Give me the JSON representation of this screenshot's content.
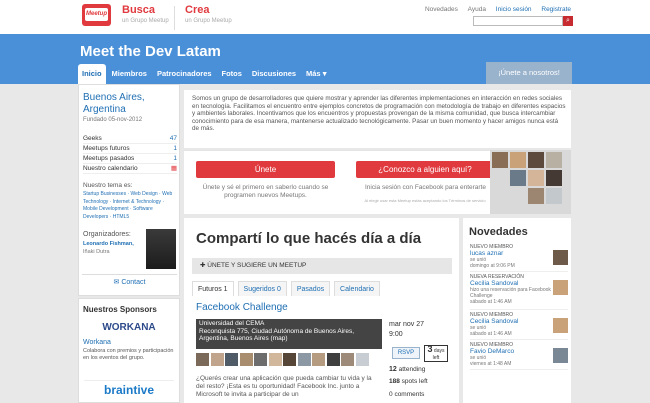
{
  "header": {
    "logo_text": "Meetup",
    "hubs": [
      {
        "title": "Busca",
        "subtitle": "un Grupo Meetup"
      },
      {
        "title": "Crea",
        "subtitle": "un Grupo Meetup"
      }
    ],
    "links": [
      "Novedades",
      "Ayuda",
      "Inicio sesión",
      "Registrate"
    ],
    "search_placeholder": ""
  },
  "group": {
    "title": "Meet the Dev Latam",
    "nav": [
      "Inicio",
      "Miembros",
      "Patrocinadores",
      "Fotos",
      "Discusiones",
      "Más ▾"
    ],
    "join_label": "¡Únete a nosotros!"
  },
  "sidebar": {
    "city": "Buenos Aires, Argentina",
    "founded": "Fundado 05-nov-2012",
    "stats": [
      {
        "label": "Geeks",
        "value": "47"
      },
      {
        "label": "Meetups futuros",
        "value": "1"
      },
      {
        "label": "Meetups pasados",
        "value": "1"
      },
      {
        "label": "Nuestro calendario",
        "value": ""
      }
    ],
    "topics_title": "Nuestro tema es:",
    "topics": "Startup Businesses · Web Design · Web Technology · Internet & Technology · Mobile Development · Software Developers · HTML5",
    "org_title": "Organizadores:",
    "org_name": "Leonardo Fishman,",
    "org_extra": "Iñaki Dutra",
    "contact_label": "Contact"
  },
  "sponsors": {
    "title": "Nuestros Sponsors",
    "logo1": "WORKANA",
    "name": "Workana",
    "desc": "Colabora con premios y participación en los eventos del grupo.",
    "logo2": "braintive"
  },
  "description": "Somos un grupo de desarrolladores que quiere mostrar y aprender las diferentes implementaciones en interacción en redes sociales en tecnología. Facilitamos el encuentro entre ejemplos concretos de programación con metodología de trabajo en diferentes espacios y ambientes laborales. Incentivamos que los encuentros y propuestas provengan de la misma comunidad, que busca intercambiar conocimiento para de esa manera, mantenerse actualizado tecnológicamente. Pasar un buen momento y hacer amigos nunca está de más.",
  "cta": {
    "join_label": "Únete",
    "join_text": "Únete y sé el primero en saberlo cuando se programen nuevos Meetups.",
    "know_label": "¿Conozco a alguien aquí?",
    "know_text": "Inicia sesión con Facebook para enterarte",
    "know_fine": "Al elegir usar esta Meetup estás aceptando los Términos de servicio"
  },
  "main": {
    "headline": "Compartí lo que hacés día a día",
    "suggest_label": "ÚNETE Y SUGIERE UN MEETUP",
    "tabs": [
      "Futuros 1",
      "Sugeridos 0",
      "Pasados",
      "Calendario"
    ],
    "event": {
      "title": "Facebook Challenge",
      "venue_name": "Universidad del CEMA",
      "venue_address": "Reconquista 775, Ciudad Autónoma de Buenos Aires, Argentina, Buenos Aires (map)",
      "date": "mar nov 27",
      "time": "9:00",
      "rsvp_label": "RSVP",
      "days_number": "3",
      "days_label": "days left",
      "attending_count": "12",
      "attending_label": "attending",
      "spots_count": "188",
      "spots_label": "spots left",
      "comments_count": "0",
      "comments_label": "comments",
      "description": "¿Querés crear una aplicación que pueda cambiar tu vida y la del resto? ¡Esta es tu oportunidad! Facebook Inc. junto a Microsoft te invita a participar de un"
    }
  },
  "news": {
    "title": "Novedades",
    "items": [
      {
        "tag": "NUEVO MIEMBRO",
        "name": "lucas aznar",
        "sub": "se unió",
        "time": "domingo at 9:06 PM"
      },
      {
        "tag": "NUEVA RESERVACIÓN",
        "name": "Cecilia Sandoval",
        "sub": "hizo una reservación para Facebook Challenge",
        "time": "sábado at 1:46 AM"
      },
      {
        "tag": "NUEVO MIEMBRO",
        "name": "Cecilia Sandoval",
        "sub": "se unió",
        "time": "sábado at 1:46 AM"
      },
      {
        "tag": "NUEVO MIEMBRO",
        "name": "Favio DeMarco",
        "sub": "se unió",
        "time": "viernes at 1:48 AM"
      }
    ]
  },
  "colors": {
    "brand_red": "#e0393e",
    "banner_blue": "#4a90d9",
    "link_blue": "#1f6fb3"
  }
}
